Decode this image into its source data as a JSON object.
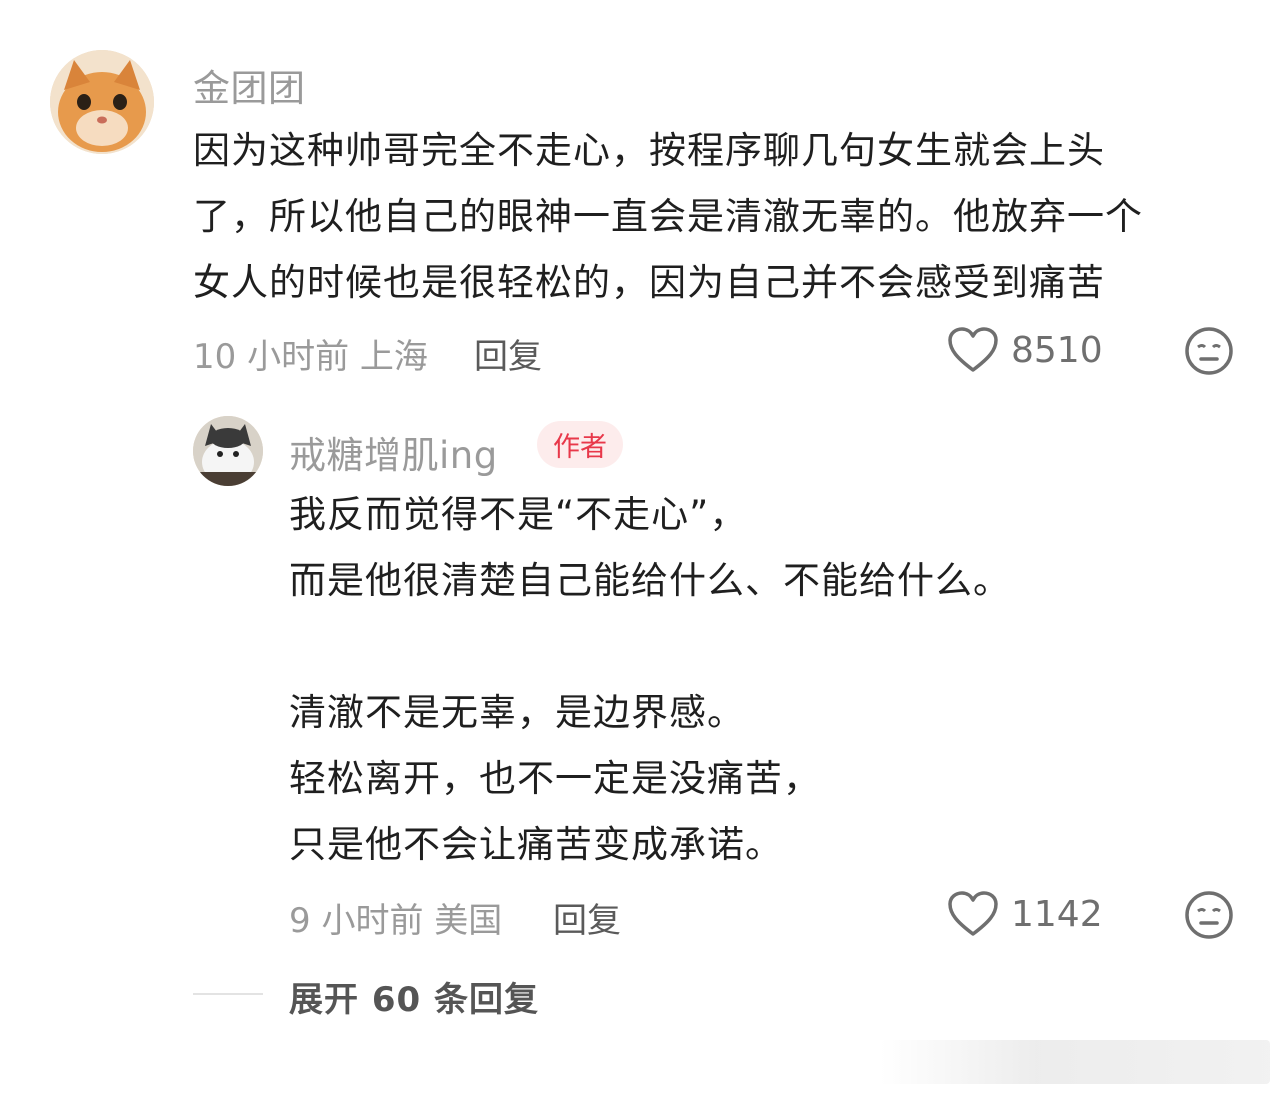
{
  "comments": [
    {
      "author": "金团团",
      "lines": [
        "因为这种帅哥完全不走心，按程序聊几句女生就会上头",
        "了，所以他自己的眼神一直会是清澈无辜的。他放弃一个",
        "女人的时候也是很轻松的，因为自己并不会感受到痛苦"
      ],
      "time_location": "10 小时前 上海",
      "reply_label": "回复",
      "likes": "8510",
      "avatar_icon": "cat-avatar-orange"
    }
  ],
  "reply": {
    "author": "戒糖增肌ing",
    "badge": "作者",
    "lines": [
      "我反而觉得不是“不走心”，",
      "而是他很清楚自己能给什么、不能给什么。",
      "",
      "清澈不是无辜，是边界感。",
      "轻松离开，也不一定是没痛苦，",
      "只是他不会让痛苦变成承诺。"
    ],
    "time_location": "9 小时前 美国",
    "reply_label": "回复",
    "likes": "1142",
    "avatar_icon": "cat-avatar-white"
  },
  "expand_label": "展开 60 条回复",
  "colors": {
    "badge_text": "#e8384a",
    "badge_bg": "#fdecec",
    "meta": "#9a9a9a"
  }
}
